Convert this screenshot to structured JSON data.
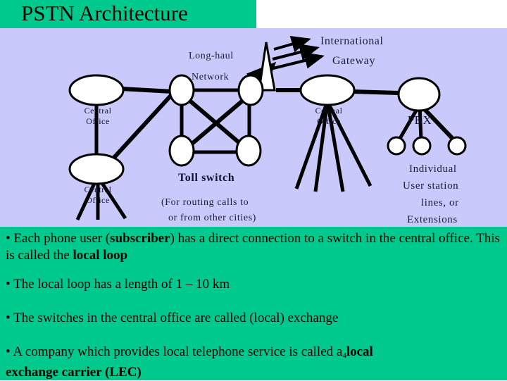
{
  "slide": {
    "title": "PSTN Architecture",
    "title_bar_color": "#00c98d",
    "diagram_bg_color": "#c9c9fb",
    "body_bg_color": "#00c98d"
  },
  "diagram": {
    "labels": {
      "long_haul": "Long-haul",
      "network": "Network",
      "international": "International",
      "gateway": "Gateway",
      "toll_switch": "Toll switch",
      "routing_note_line1": "(For routing calls to",
      "routing_note_line2": "or from other cities)",
      "individual_line1": "Individual",
      "individual_line2": "User station",
      "individual_line3": "lines, or",
      "individual_line4": "Extensions"
    },
    "nodes": [
      {
        "id": "central-office-top-left",
        "label_line1": "Central",
        "label_line2": "Office",
        "shape": "ellipse"
      },
      {
        "id": "central-office-bottom-left",
        "label_line1": "Central",
        "label_line2": "Office",
        "shape": "ellipse"
      },
      {
        "id": "central-office-right",
        "label_line1": "Central",
        "label_line2": "Office",
        "shape": "ellipse"
      },
      {
        "id": "pbx",
        "label_line1": "PBX",
        "label_line2": "",
        "shape": "ellipse"
      },
      {
        "id": "toll-switch-1",
        "label_line1": "",
        "label_line2": "",
        "shape": "ellipse"
      },
      {
        "id": "toll-switch-2",
        "label_line1": "",
        "label_line2": "",
        "shape": "ellipse"
      },
      {
        "id": "toll-switch-3",
        "label_line1": "",
        "label_line2": "",
        "shape": "ellipse"
      },
      {
        "id": "toll-switch-4",
        "label_line1": "",
        "label_line2": "",
        "shape": "ellipse"
      },
      {
        "id": "user-station-1",
        "label_line1": "",
        "label_line2": "",
        "shape": "circle"
      },
      {
        "id": "user-station-2",
        "label_line1": "",
        "label_line2": "",
        "shape": "circle"
      },
      {
        "id": "user-station-3",
        "label_line1": "",
        "label_line2": "",
        "shape": "circle"
      }
    ]
  },
  "bullets": {
    "b1_part1": "• Each phone user (",
    "b1_bold1": "subscriber",
    "b1_part2": ") has a direct connection to a switch in the central office. This is called the ",
    "b1_bold2": "local loop",
    "b2": "• The local loop has a length of  1 – 10 km",
    "b3": "•  The switches in the central office are called (local) exchange",
    "b4_part1": "•  A  company  which  provides  local  telephone  service  is  called  a",
    "b4_sub": "4",
    "b4_bold1": "local",
    "b4_bold2": "exchange carrier (LEC)"
  }
}
